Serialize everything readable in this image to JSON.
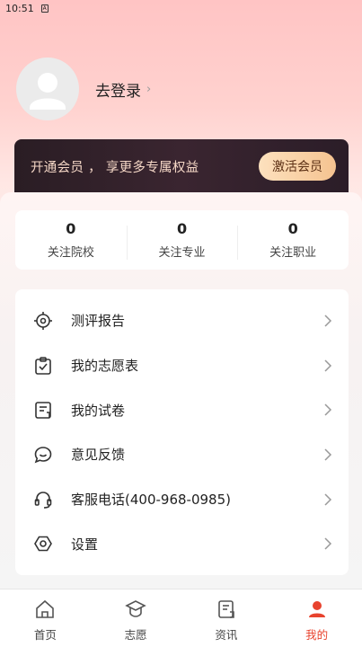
{
  "status_bar": {
    "time": "10:51",
    "sim_icon": "A"
  },
  "profile": {
    "login_label": "去登录",
    "chevron": "›"
  },
  "vip": {
    "promo_text": "开通会员 ， 享更多专属权益",
    "activate_label": "激活会员"
  },
  "stats": [
    {
      "count": "0",
      "label": "关注院校"
    },
    {
      "count": "0",
      "label": "关注专业"
    },
    {
      "count": "0",
      "label": "关注职业"
    }
  ],
  "menu": [
    {
      "label": "测评报告",
      "icon": "target-icon"
    },
    {
      "label": "我的志愿表",
      "icon": "clipboard-check-icon"
    },
    {
      "label": "我的试卷",
      "icon": "document-icon"
    },
    {
      "label": "意见反馈",
      "icon": "chat-bubble-icon"
    },
    {
      "label": "客服电话(400-968-0985)",
      "icon": "headset-icon"
    },
    {
      "label": "设置",
      "icon": "settings-hexagon-icon"
    }
  ],
  "tabs": [
    {
      "label": "首页",
      "icon": "home-icon",
      "active": false
    },
    {
      "label": "志愿",
      "icon": "graduation-cap-icon",
      "active": false
    },
    {
      "label": "资讯",
      "icon": "news-icon",
      "active": false
    },
    {
      "label": "我的",
      "icon": "user-icon",
      "active": true
    }
  ],
  "colors": {
    "accent": "#e8432e",
    "vip_bg": "#2a1d24",
    "vip_btn": "#f5c390"
  }
}
